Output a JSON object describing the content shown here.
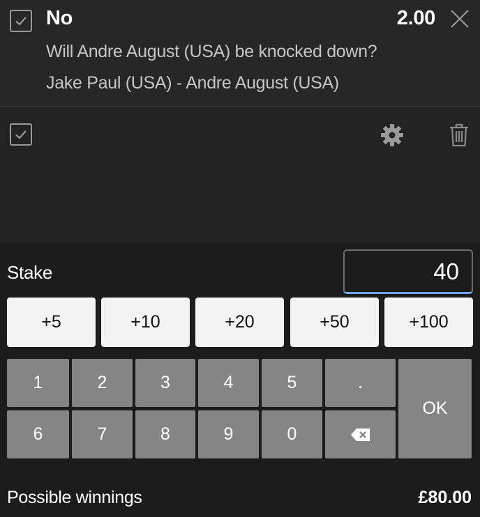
{
  "selection": {
    "title": "No",
    "odds": "2.00",
    "market": "Will Andre August (USA) be knocked down?",
    "event": "Jake Paul (USA) - Andre August (USA)"
  },
  "stake": {
    "label": "Stake",
    "value": "40"
  },
  "quick_stakes": [
    "+5",
    "+10",
    "+20",
    "+50",
    "+100"
  ],
  "keypad": {
    "keys": [
      "1",
      "2",
      "3",
      "4",
      "5",
      ".",
      "6",
      "7",
      "8",
      "9",
      "0"
    ],
    "ok_label": "OK",
    "backspace_icon": "backspace-icon"
  },
  "icons": [
    "checkbox-icon",
    "close-icon",
    "gear-icon",
    "trash-icon",
    "backspace-icon"
  ],
  "colors": {
    "input_underline": "#6ea4e8",
    "key_bg": "#858585",
    "quick_bg": "#f3f3f3"
  },
  "winnings": {
    "label": "Possible winnings",
    "value": "£80.00"
  }
}
